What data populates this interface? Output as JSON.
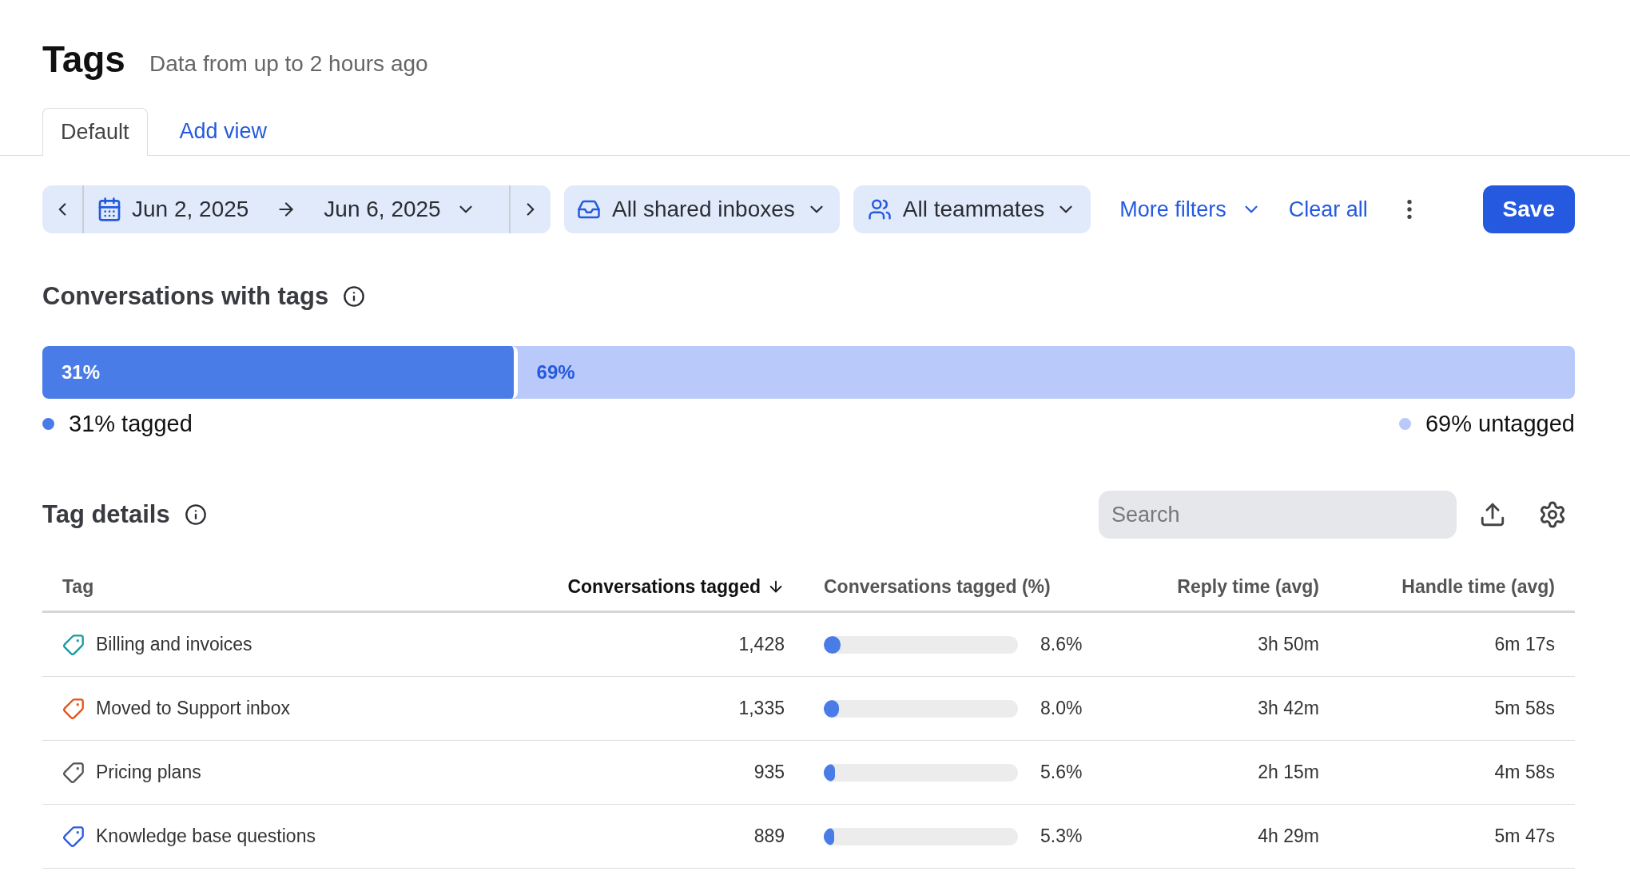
{
  "header": {
    "title": "Tags",
    "subtitle": "Data from up to 2 hours ago"
  },
  "tabs": [
    {
      "label": "Default",
      "selected": true
    },
    {
      "label": "Add view",
      "selected": false
    }
  ],
  "filters": {
    "date_start": "Jun 2, 2025",
    "date_end": "Jun 6, 2025",
    "inboxes": "All shared inboxes",
    "teammates": "All teammates",
    "more_filters": "More filters",
    "clear_all": "Clear all",
    "save": "Save"
  },
  "summary": {
    "title": "Conversations with tags",
    "level": 0.31,
    "tagged_label": "31%",
    "untagged_label": "69%",
    "tagged_legend": "31% tagged",
    "untagged_legend": "69% untagged"
  },
  "details": {
    "title": "Tag details",
    "search": {
      "placeholder": "Search"
    }
  },
  "table": {
    "columns": [
      {
        "label": "Tag",
        "sorted": false
      },
      {
        "label": "Conversations tagged",
        "sorted": true
      },
      {
        "label": "Conversations tagged (%)",
        "sorted": false
      },
      {
        "label": "Reply time (avg)",
        "sorted": false
      },
      {
        "label": "Handle time (avg)",
        "sorted": false
      }
    ],
    "rows": [
      {
        "tag": "Billing and invoices",
        "color": "#1a9aa0",
        "count": "1,428",
        "level": 0.086,
        "percent": "8.6%",
        "reply": "3h 50m",
        "handle": "6m 17s"
      },
      {
        "tag": "Moved to Support inbox",
        "color": "#e5531a",
        "count": "1,335",
        "level": 0.08,
        "percent": "8.0%",
        "reply": "3h 42m",
        "handle": "5m 58s"
      },
      {
        "tag": "Pricing plans",
        "color": "#555555",
        "count": "935",
        "level": 0.056,
        "percent": "5.6%",
        "reply": "2h 15m",
        "handle": "4m 58s"
      },
      {
        "tag": "Knowledge base questions",
        "color": "#2b5be0",
        "count": "889",
        "level": 0.053,
        "percent": "5.3%",
        "reply": "4h 29m",
        "handle": "5m 47s"
      }
    ]
  }
}
